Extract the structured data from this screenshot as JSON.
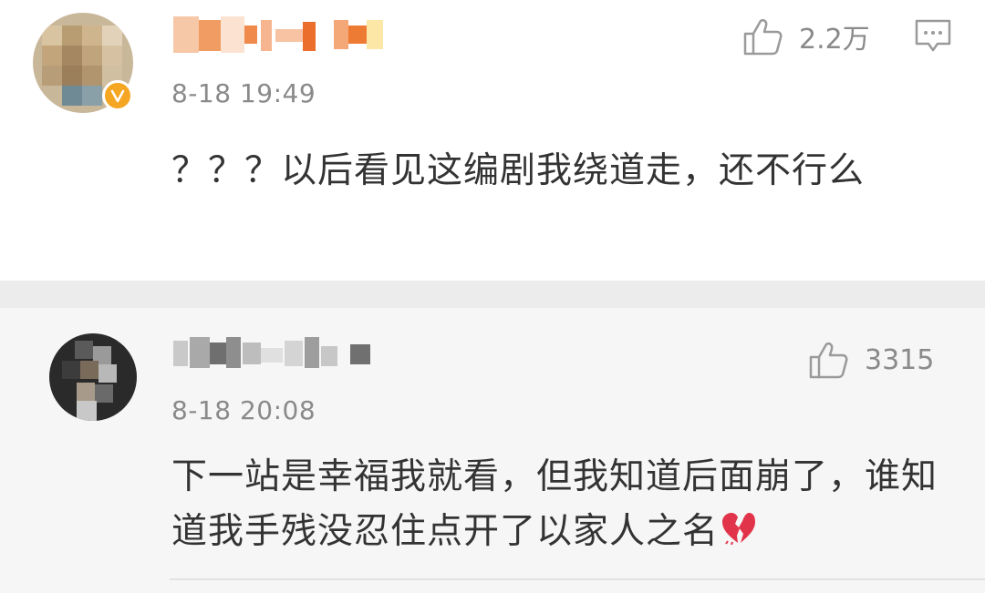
{
  "comments": [
    {
      "timestamp": "8-18 19:49",
      "likes": "2.2万",
      "verified": true,
      "body": "？？？以后看见这编剧我绕道走，还不行么"
    },
    {
      "timestamp": "8-18 20:08",
      "likes": "3315",
      "verified": false,
      "body": "下一站是幸福我就看，但我知道后面崩了，谁知道我手残没忍住点开了以家人之名",
      "trailing_emoji": "broken-heart-icon"
    }
  ],
  "icons": {
    "like": "thumbs-up-icon",
    "reply": "comment-bubble-icon",
    "verified": "verified-badge-icon"
  },
  "colors": {
    "muted_text": "#8a8a8a",
    "body_text": "#333333",
    "verified_badge": "#f5a623",
    "separator": "#ececec",
    "second_comment_bg": "#f6f6f6"
  }
}
